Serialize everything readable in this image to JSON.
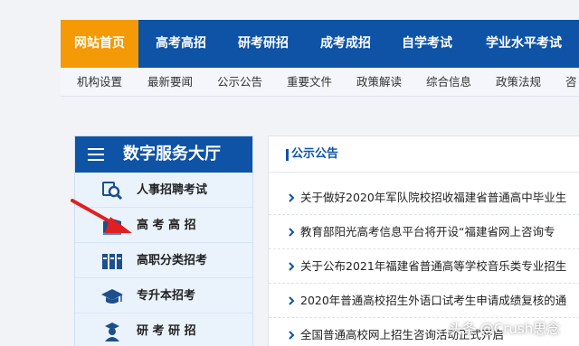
{
  "main_nav": [
    "网站首页",
    "高考高招",
    "研考研招",
    "成考成招",
    "自学考试",
    "学业水平考试"
  ],
  "sub_nav": [
    "机构设置",
    "最新要闻",
    "公示公告",
    "重要文件",
    "政策解读",
    "综合信息",
    "政策法规",
    "咨"
  ],
  "service": {
    "title": "数字服务大厅",
    "items": [
      {
        "label": "人事招聘考试",
        "icon": "search-person-icon"
      },
      {
        "label": "高 考 高 招",
        "icon": "book-icon"
      },
      {
        "label": "高职分类招考",
        "icon": "books-icon"
      },
      {
        "label": "专升本招考",
        "icon": "graduation-cap-icon"
      },
      {
        "label": "研 考 研 招",
        "icon": "graduate-icon"
      }
    ]
  },
  "notices": {
    "title": "公示公告",
    "items": [
      "关于做好2020年军队院校招收福建省普通高中毕业生",
      "教育部阳光高考信息平台将开设“福建省网上咨询专",
      "关于公布2021年福建省普通高等学校音乐类专业招生",
      "2020年普通高校招生外语口试考生申请成绩复核的通",
      "全国普通高校网上招生咨询活动正式开启"
    ]
  },
  "watermark": "头条 @Crush思念",
  "colors": {
    "brand_blue": "#0e53a6",
    "active_orange": "#f49a06",
    "arrow_red": "#e02020"
  }
}
